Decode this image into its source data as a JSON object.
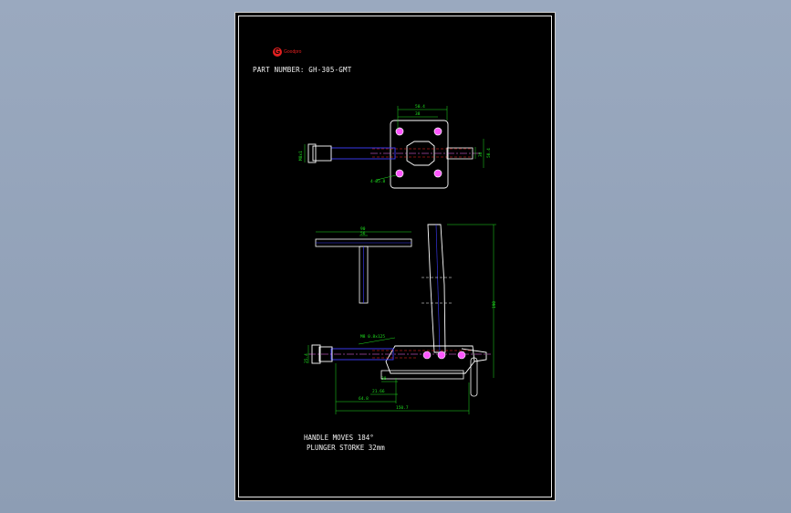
{
  "brand": {
    "logo_text": "Goodpro"
  },
  "title": {
    "part_number": "PART NUMBER:  GH-305-GMT"
  },
  "notes": {
    "handle": "HANDLE  MOVES  184°",
    "stroke": "PLUNGER  STORKE  32mm"
  },
  "dims": {
    "top_width_outer": "50.4",
    "top_width_inner": "38",
    "left_dia": "M8x1",
    "hole_spec": "4-Ø5.8",
    "right_a": "38",
    "right_b": "50.4",
    "handle_width": "90",
    "handle_inner": "56",
    "height_total": "190",
    "thread": "M8 0.8x125",
    "left_height": "25.4",
    "d1": "21.66",
    "d2": "38",
    "d3": "64.8",
    "d4": "150.7"
  },
  "colors": {
    "dim": "#1fe01f",
    "part": "#ffffff",
    "accent": "#3d3dff",
    "hidden": "#ff2a2a",
    "center": "#ff6fff"
  }
}
